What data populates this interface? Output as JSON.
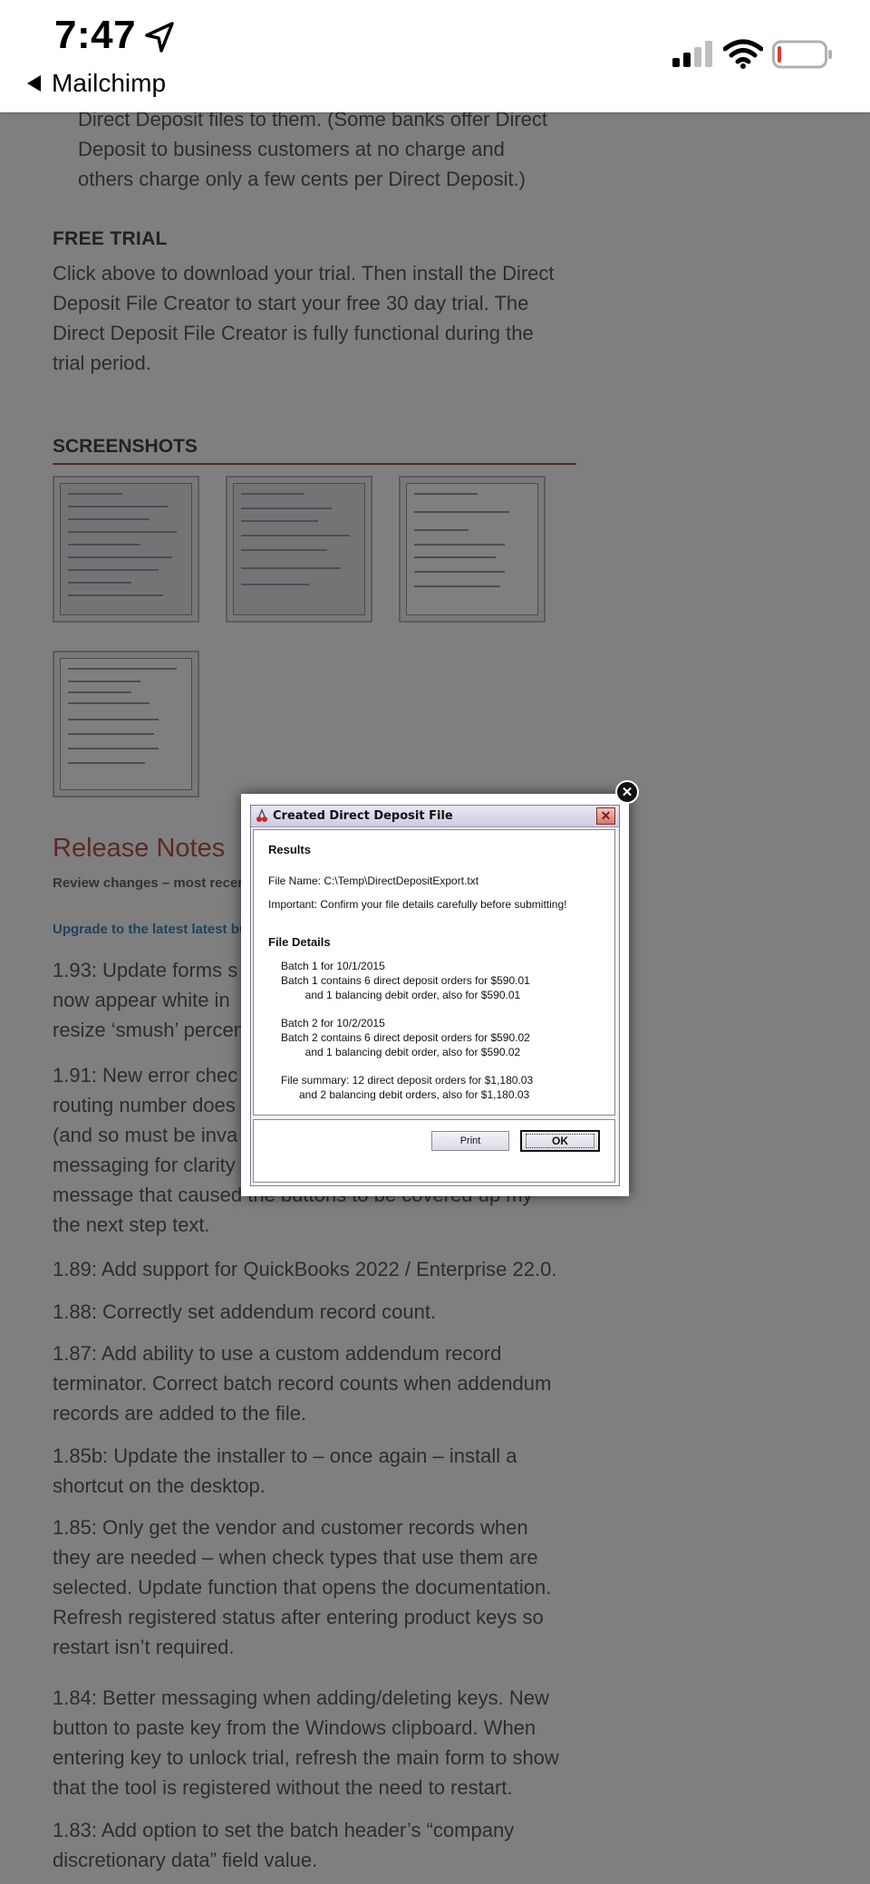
{
  "status_bar": {
    "time": "7:47",
    "back_label": "Mailchimp",
    "battery_color": "#e23b36"
  },
  "page": {
    "intro_lines": [
      "Direct Deposit files to them. (Some banks offer Direct",
      "Deposit to business customers at no charge and",
      "others charge only a few cents per Direct Deposit.)"
    ],
    "free_trial": {
      "heading": "FREE TRIAL",
      "lines": [
        "Click above to download your trial.  Then install the Direct",
        "Deposit File Creator to start your free 30 day trial.  The",
        "Direct Deposit File Creator is fully functional during the",
        "trial period."
      ]
    },
    "screenshots": {
      "heading": "SCREENSHOTS"
    },
    "release_notes": {
      "title": "Release Notes",
      "subtitle": "Review changes – most recent",
      "upgrade_link": "Upgrade to the latest latest bu",
      "visible_partial": [
        {
          "lines": [
            "1.93: Update forms s",
            "now appear white in",
            "resize ‘smush’ percen"
          ]
        },
        {
          "lines": [
            "1.91: New error chec",
            "routing number does",
            "(and so must be inva",
            "messaging for clarity",
            "message that caused the buttons to be covered up my",
            "the next step text."
          ]
        }
      ],
      "notes": [
        {
          "lines": [
            "1.89: Add support for QuickBooks 2022 / Enterprise 22.0."
          ]
        },
        {
          "lines": [
            "1.88: Correctly set addendum record count."
          ]
        },
        {
          "lines": [
            "1.87: Add ability to use a custom addendum record",
            "terminator. Correct batch record counts when addendum",
            "records are added to the file."
          ]
        },
        {
          "lines": [
            "1.85b: Update the installer to – once again – install a",
            "shortcut on the desktop."
          ]
        },
        {
          "lines": [
            "1.85: Only get the vendor and customer records when",
            "they are needed  – when check types that use them are",
            "selected. Update function that opens the documentation.",
            "Refresh registered status after entering product keys so",
            "restart isn’t required."
          ]
        },
        {
          "lines": [
            "1.84: Better messaging when adding/deleting keys. New",
            "button to paste key from the Windows clipboard. When",
            "entering key to unlock trial, refresh the main form to show",
            "that the tool is registered without the need to restart."
          ]
        },
        {
          "lines": [
            "1.83: Add option to set the batch header’s “company",
            "discretionary data” field value."
          ]
        }
      ]
    }
  },
  "dialog": {
    "title": "Created Direct Deposit File",
    "results_heading": "Results",
    "file_name": "File Name: C:\\Temp\\DirectDepositExport.txt",
    "important": "Important: Confirm your file details carefully before submitting!",
    "details_heading": "File Details",
    "batch1_lines": [
      "Batch 1 for 10/1/2015",
      "Batch 1 contains 6 direct deposit orders for $590.01",
      "        and 1 balancing debit order, also for $590.01"
    ],
    "batch2_lines": [
      "Batch 2 for 10/2/2015",
      "Batch 2 contains 6 direct deposit orders for $590.02",
      "        and 1 balancing debit order, also for $590.02"
    ],
    "summary_lines": [
      "File summary: 12 direct deposit orders for $1,180.03",
      "      and 2 balancing debit orders, also for $1,180.03"
    ],
    "print_label": "Print",
    "ok_label": "OK"
  }
}
